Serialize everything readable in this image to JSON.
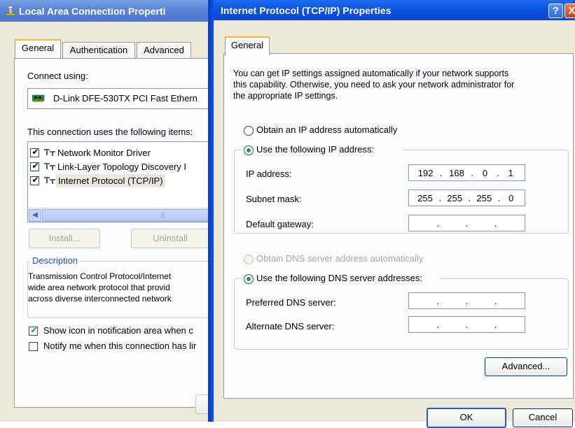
{
  "back_window": {
    "title": "Local Area Connection Properti",
    "tabs": [
      "General",
      "Authentication",
      "Advanced"
    ],
    "connect_using_label": "Connect using:",
    "adapter": "D-Link DFE-530TX PCI Fast Ethern",
    "items_label": "This connection uses the following items:",
    "items": [
      {
        "label": "Network Monitor Driver",
        "checked": true
      },
      {
        "label": "Link-Layer Topology Discovery I",
        "checked": true
      },
      {
        "label": "Internet Protocol (TCP/IP)",
        "checked": true
      }
    ],
    "install_label": "Install...",
    "uninstall_label": "Uninstall",
    "description_label": "Description",
    "description_lines": [
      "Transmission Control Protocol/Internet",
      "wide area network protocol that provid",
      "across diverse interconnected network"
    ],
    "show_icon_label": "Show icon in notification area when c",
    "notify_label": "Notify me when this connection has lir"
  },
  "front_window": {
    "title": "Internet Protocol (TCP/IP) Properties",
    "help_symbol": "?",
    "close_symbol": "X",
    "tab": "General",
    "intro_lines": [
      "You can get IP settings assigned automatically if your network supports",
      "this capability. Otherwise, you need to ask your network administrator for",
      "the appropriate IP settings."
    ],
    "obtain_ip_label": "Obtain an IP address automatically",
    "use_ip_label": "Use the following IP address:",
    "ip_label": "IP address:",
    "ip_value": [
      "192",
      "168",
      "0",
      "1"
    ],
    "subnet_label": "Subnet mask:",
    "subnet_value": [
      "255",
      "255",
      "255",
      "0"
    ],
    "gateway_label": "Default gateway:",
    "obtain_dns_label": "Obtain DNS server address automatically",
    "use_dns_label": "Use the following DNS server addresses:",
    "preferred_dns_label": "Preferred DNS server:",
    "alternate_dns_label": "Alternate DNS server:",
    "advanced_label": "Advanced...",
    "ok_label": "OK",
    "cancel_label": "Cancel"
  },
  "colors": {
    "title_bar": "#0a52e0",
    "dialog_bg": "#ece9d8",
    "radio_dot": "#21a121"
  }
}
